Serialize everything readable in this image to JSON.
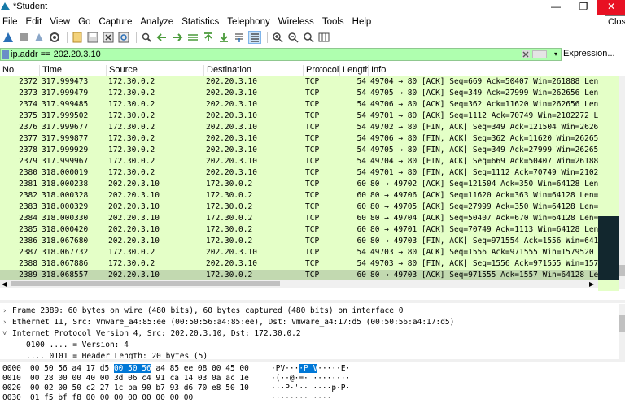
{
  "window": {
    "title": "*Student",
    "tooltip": "Close",
    "min_glyph": "—",
    "max_glyph": "❐",
    "close_glyph": "✕"
  },
  "menu": [
    "File",
    "Edit",
    "View",
    "Go",
    "Capture",
    "Analyze",
    "Statistics",
    "Telephony",
    "Wireless",
    "Tools",
    "Help"
  ],
  "filter": {
    "value": "ip.addr == 202.20.3.10",
    "expression_label": "Expression...",
    "dropdown_glyph": "▾"
  },
  "packet_list": {
    "columns": [
      "No.",
      "Time",
      "Source",
      "Destination",
      "Protocol",
      "Length",
      "Info"
    ],
    "rows": [
      {
        "no": "2372",
        "time": "317.999473",
        "src": "172.30.0.2",
        "dst": "202.20.3.10",
        "proto": "TCP",
        "len": "54",
        "info": "49704 → 80 [ACK] Seq=669 Ack=50407 Win=261888 Len="
      },
      {
        "no": "2373",
        "time": "317.999479",
        "src": "172.30.0.2",
        "dst": "202.20.3.10",
        "proto": "TCP",
        "len": "54",
        "info": "49705 → 80 [ACK] Seq=349 Ack=27999 Win=262656 Len="
      },
      {
        "no": "2374",
        "time": "317.999485",
        "src": "172.30.0.2",
        "dst": "202.20.3.10",
        "proto": "TCP",
        "len": "54",
        "info": "49706 → 80 [ACK] Seq=362 Ack=11620 Win=262656 Len="
      },
      {
        "no": "2375",
        "time": "317.999502",
        "src": "172.30.0.2",
        "dst": "202.20.3.10",
        "proto": "TCP",
        "len": "54",
        "info": "49701 → 80 [ACK] Seq=1112 Ack=70749 Win=2102272 L"
      },
      {
        "no": "2376",
        "time": "317.999677",
        "src": "172.30.0.2",
        "dst": "202.20.3.10",
        "proto": "TCP",
        "len": "54",
        "info": "49702 → 80 [FIN, ACK] Seq=349 Ack=121504 Win=2626"
      },
      {
        "no": "2377",
        "time": "317.999877",
        "src": "172.30.0.2",
        "dst": "202.20.3.10",
        "proto": "TCP",
        "len": "54",
        "info": "49706 → 80 [FIN, ACK] Seq=362 Ack=11620 Win=26265"
      },
      {
        "no": "2378",
        "time": "317.999929",
        "src": "172.30.0.2",
        "dst": "202.20.3.10",
        "proto": "TCP",
        "len": "54",
        "info": "49705 → 80 [FIN, ACK] Seq=349 Ack=27999 Win=26265"
      },
      {
        "no": "2379",
        "time": "317.999967",
        "src": "172.30.0.2",
        "dst": "202.20.3.10",
        "proto": "TCP",
        "len": "54",
        "info": "49704 → 80 [FIN, ACK] Seq=669 Ack=50407 Win=26188"
      },
      {
        "no": "2380",
        "time": "318.000019",
        "src": "172.30.0.2",
        "dst": "202.20.3.10",
        "proto": "TCP",
        "len": "54",
        "info": "49701 → 80 [FIN, ACK] Seq=1112 Ack=70749 Win=2102"
      },
      {
        "no": "2381",
        "time": "318.000238",
        "src": "202.20.3.10",
        "dst": "172.30.0.2",
        "proto": "TCP",
        "len": "60",
        "info": "80 → 49702 [ACK] Seq=121504 Ack=350 Win=64128 Len="
      },
      {
        "no": "2382",
        "time": "318.000328",
        "src": "202.20.3.10",
        "dst": "172.30.0.2",
        "proto": "TCP",
        "len": "60",
        "info": "80 → 49706 [ACK] Seq=11620 Ack=363 Win=64128 Len="
      },
      {
        "no": "2383",
        "time": "318.000329",
        "src": "202.20.3.10",
        "dst": "172.30.0.2",
        "proto": "TCP",
        "len": "60",
        "info": "80 → 49705 [ACK] Seq=27999 Ack=350 Win=64128 Len="
      },
      {
        "no": "2384",
        "time": "318.000330",
        "src": "202.20.3.10",
        "dst": "172.30.0.2",
        "proto": "TCP",
        "len": "60",
        "info": "80 → 49704 [ACK] Seq=50407 Ack=670 Win=64128 Len="
      },
      {
        "no": "2385",
        "time": "318.000420",
        "src": "202.20.3.10",
        "dst": "172.30.0.2",
        "proto": "TCP",
        "len": "60",
        "info": "80 → 49701 [ACK] Seq=70749 Ack=1113 Win=64128 Len="
      },
      {
        "no": "2386",
        "time": "318.067680",
        "src": "202.20.3.10",
        "dst": "172.30.0.2",
        "proto": "TCP",
        "len": "60",
        "info": "80 → 49703 [FIN, ACK] Seq=971554 Ack=1556 Win=641"
      },
      {
        "no": "2387",
        "time": "318.067732",
        "src": "172.30.0.2",
        "dst": "202.20.3.10",
        "proto": "TCP",
        "len": "54",
        "info": "49703 → 80 [ACK] Seq=1556 Ack=971555 Win=1579520"
      },
      {
        "no": "2388",
        "time": "318.067886",
        "src": "172.30.0.2",
        "dst": "202.20.3.10",
        "proto": "TCP",
        "len": "54",
        "info": "49703 → 80 [FIN, ACK] Seq=1556 Ack=971555 Win=157"
      },
      {
        "no": "2389",
        "time": "318.068557",
        "src": "202.20.3.10",
        "dst": "172.30.0.2",
        "proto": "TCP",
        "len": "60",
        "info": "80 → 49703 [ACK] Seq=971555 Ack=1557 Win=64128 Le"
      }
    ],
    "selected_index": 17
  },
  "details": [
    {
      "toggle": "›",
      "text": "Frame 2389: 60 bytes on wire (480 bits), 60 bytes captured (480 bits) on interface 0",
      "child": false
    },
    {
      "toggle": "›",
      "text": "Ethernet II, Src: Vmware_a4:85:ee (00:50:56:a4:85:ee), Dst: Vmware_a4:17:d5 (00:50:56:a4:17:d5)",
      "child": false
    },
    {
      "toggle": "˅",
      "text": "Internet Protocol Version 4, Src: 202.20.3.10, Dst: 172.30.0.2",
      "child": false
    },
    {
      "toggle": "",
      "text": "0100 .... = Version: 4",
      "child": true
    },
    {
      "toggle": "",
      "text": ".... 0101 = Header Length: 20 bytes (5)",
      "child": true
    }
  ],
  "hex": [
    {
      "offset": "0000",
      "pre": "00 50 56 a4 17 d5 ",
      "hl": "00 50 56",
      "post": " a4 85 ee 08 00 45 00",
      "ascii_pre": "·PV···",
      "ascii_hl": "·P V",
      "ascii_post": "·····E·"
    },
    {
      "offset": "0010",
      "pre": "00 28 00 00 40 00 3d 06  c4 91 ca 14 03 0a ac 1e",
      "hl": "",
      "post": "",
      "ascii_pre": "·(··@·=· ········",
      "ascii_hl": "",
      "ascii_post": ""
    },
    {
      "offset": "0020",
      "pre": "00 02 00 50 c2 27 1c ba  90 b7 93 d6 70 e8 50 10",
      "hl": "",
      "post": "",
      "ascii_pre": "···P·'·· ····p·P·",
      "ascii_hl": "",
      "ascii_post": ""
    },
    {
      "offset": "0030",
      "pre": "01 f5 bf f8 00 00 00 00  00 00 00 00",
      "hl": "",
      "post": "",
      "ascii_pre": "········ ····",
      "ascii_hl": "",
      "ascii_post": ""
    }
  ],
  "colors": {
    "filter_valid": "#afffaf",
    "tcp_row": "#e4ffc7",
    "selected_row": "#c2d9b0",
    "close_button": "#e81123",
    "hex_highlight": "#0078d7"
  },
  "toolbar_icons": [
    "start-capture-icon",
    "stop-capture-icon",
    "restart-capture-icon",
    "capture-options-icon",
    "open-file-icon",
    "save-file-icon",
    "close-file-icon",
    "reload-file-icon",
    "find-packet-icon",
    "go-back-icon",
    "go-forward-icon",
    "go-to-packet-icon",
    "go-first-icon",
    "go-last-icon",
    "auto-scroll-icon",
    "colorize-icon",
    "zoom-in-icon",
    "zoom-out-icon",
    "normal-size-icon",
    "resize-columns-icon"
  ]
}
